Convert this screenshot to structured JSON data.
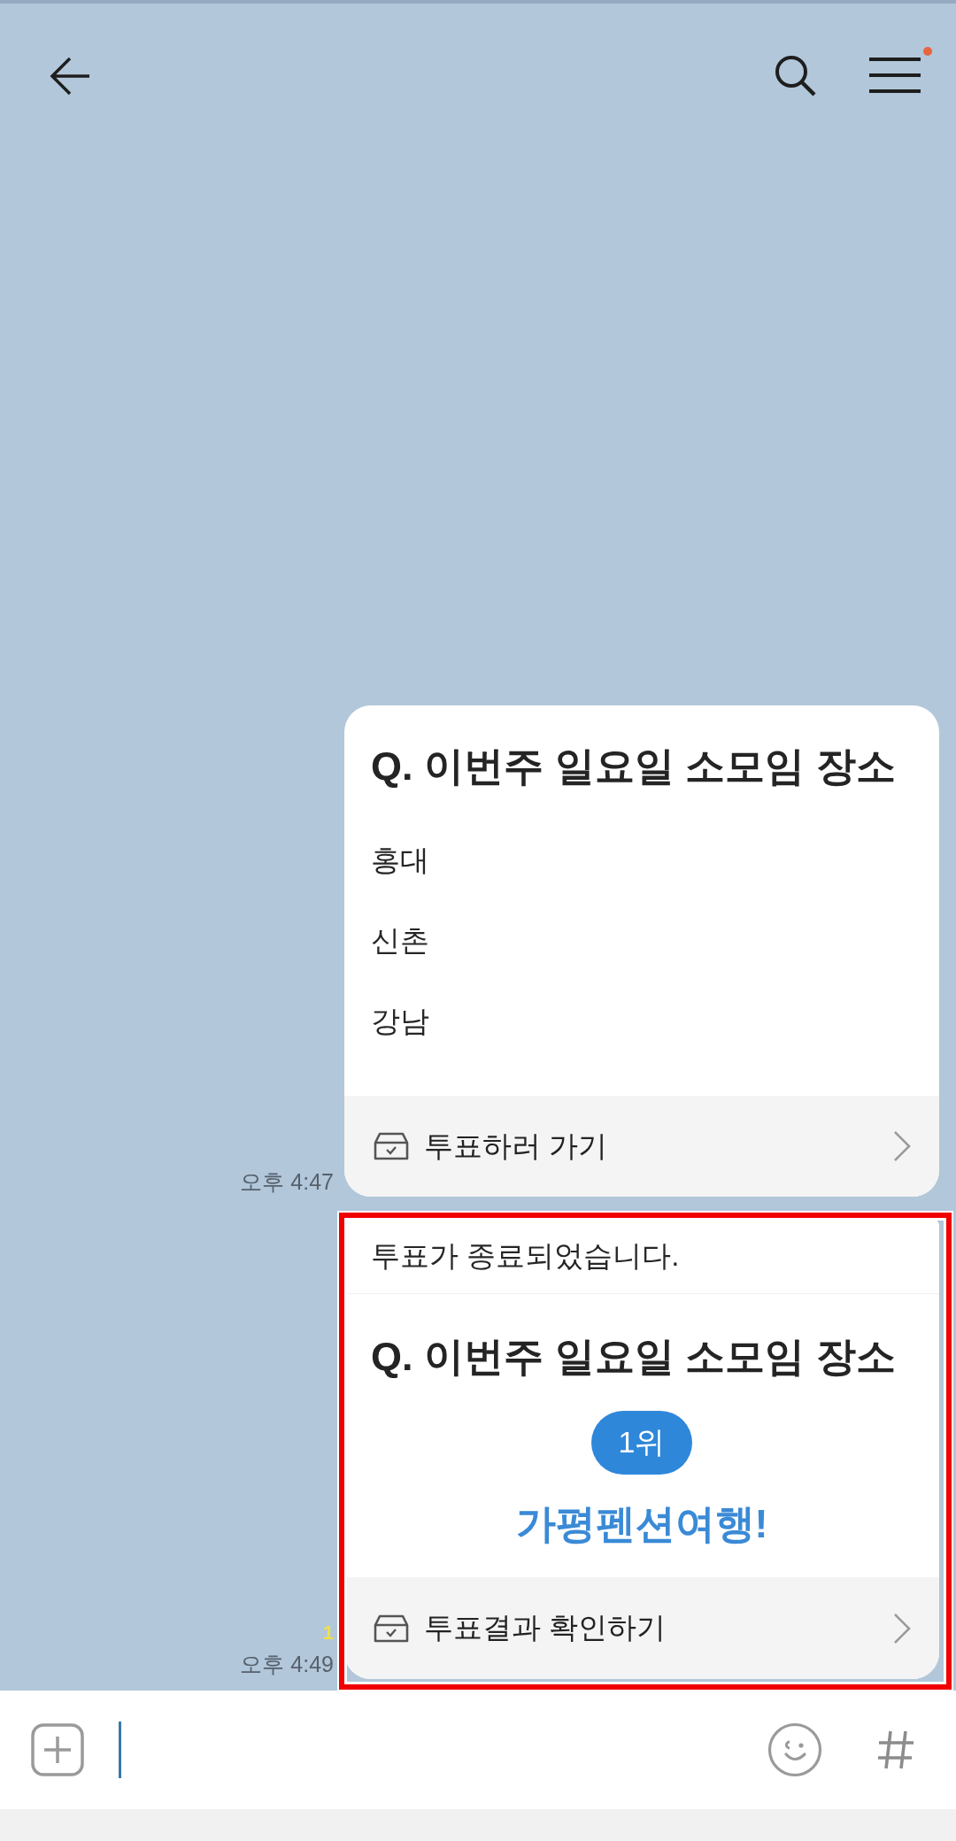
{
  "top_bar": {
    "menu_badge": true
  },
  "messages": [
    {
      "kind": "poll",
      "time": "오후 4:47",
      "question": "Q. 이번주 일요일 소모임 장소",
      "options": [
        "홍대",
        "신촌",
        "강남"
      ],
      "action": "투표하러 가기",
      "highlighted": false
    },
    {
      "kind": "poll_result",
      "time": "오후 4:49",
      "unread_count": "1",
      "notice": "투표가 종료되었습니다.",
      "question": "Q. 이번주 일요일 소모임 장소",
      "rank": "1위",
      "winner": "가평펜션여행!",
      "action": "투표결과 확인하기",
      "highlighted": true
    }
  ],
  "composer": {
    "focused": true
  }
}
